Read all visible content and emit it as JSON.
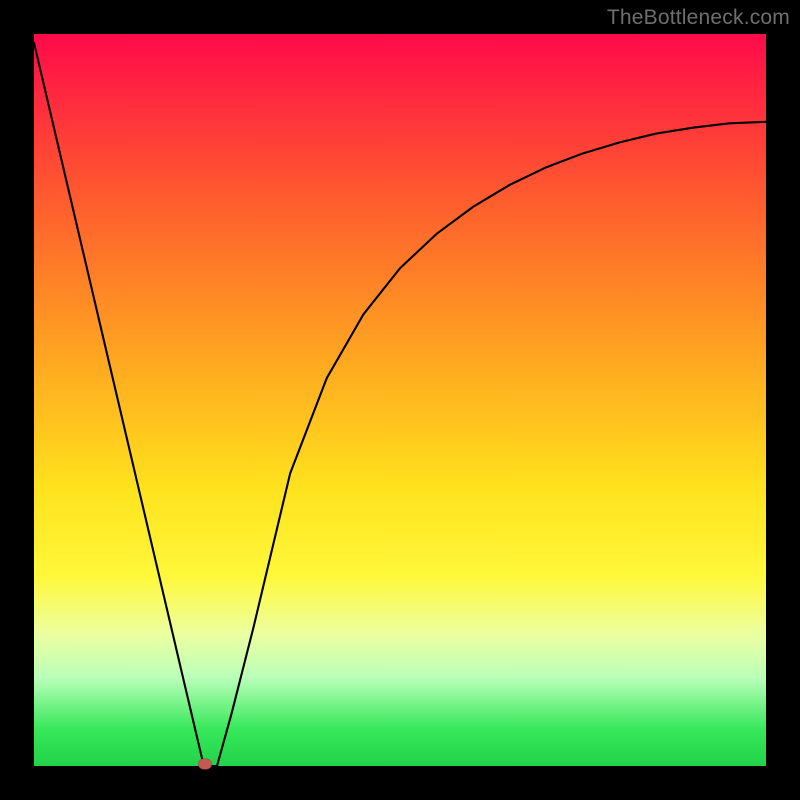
{
  "watermark": "TheBottleneck.com",
  "chart_data": {
    "type": "line",
    "title": "",
    "xlabel": "",
    "ylabel": "",
    "xlim": [
      0,
      1
    ],
    "ylim": [
      0,
      1
    ],
    "series": [
      {
        "name": "curve",
        "x": [
          0.0,
          0.05,
          0.1,
          0.15,
          0.2,
          0.232,
          0.25,
          0.27,
          0.3,
          0.35,
          0.4,
          0.45,
          0.5,
          0.55,
          0.6,
          0.65,
          0.7,
          0.75,
          0.8,
          0.85,
          0.9,
          0.95,
          1.0
        ],
        "y": [
          0.988,
          0.775,
          0.562,
          0.349,
          0.136,
          0.0,
          0.0,
          0.072,
          0.19,
          0.4,
          0.53,
          0.617,
          0.68,
          0.727,
          0.764,
          0.794,
          0.818,
          0.837,
          0.852,
          0.864,
          0.872,
          0.878,
          0.88
        ]
      }
    ],
    "marker": {
      "x": 0.234,
      "y": 0.0
    },
    "colors": {
      "curve": "#000000",
      "marker": "#c05a52",
      "gradient_top": "#ff0a4a",
      "gradient_bottom": "#22d24a",
      "frame": "#000000"
    },
    "grid": false,
    "legend": false
  }
}
